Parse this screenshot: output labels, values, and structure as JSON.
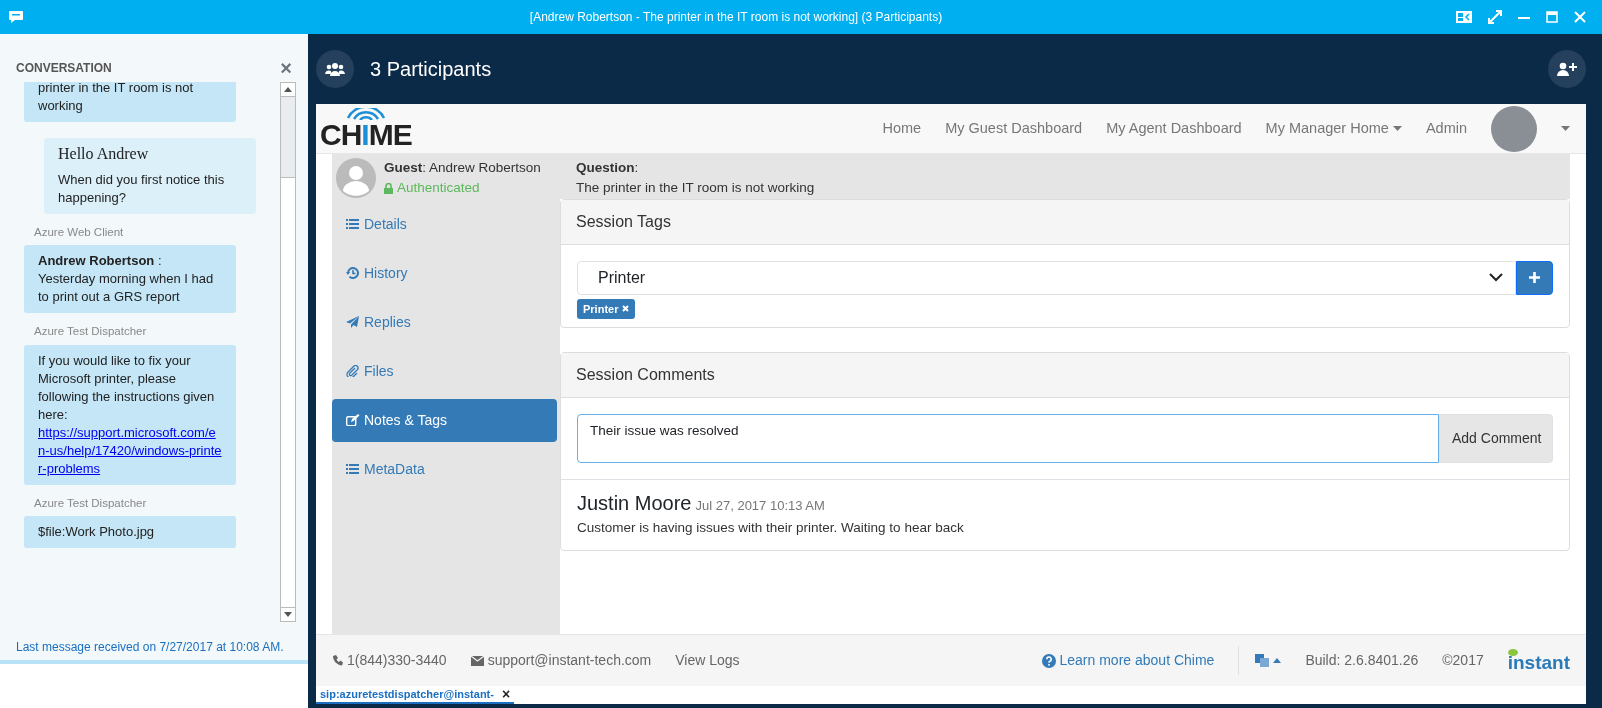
{
  "window": {
    "title": "[Andrew Robertson - The printer in the IT room is not working] (3 Participants)"
  },
  "conversation": {
    "title": "CONVERSATION",
    "close": "×",
    "messages": [
      {
        "kind": "incoming",
        "text": "printer in the IT room is not working",
        "cut": true
      },
      {
        "kind": "outgoing",
        "heading": "Hello Andrew",
        "text": "When did you first notice this happening?"
      },
      {
        "kind": "incoming",
        "sender": "Azure Web Client",
        "text": "**Andrew Robertson** : Yesterday morning when I had to print out a GRS report"
      },
      {
        "kind": "incoming",
        "sender": "Azure Test Dispatcher",
        "text": "If you would like to fix your Microsoft printer, please following the instructions given here:",
        "link": "https://support.microsoft.com/en-us/help/17420/windows-printer-problems"
      },
      {
        "kind": "incoming",
        "sender": "Azure Test Dispatcher",
        "text": "$file:Work Photo.jpg"
      }
    ],
    "status": "Last message received on 7/27/2017 at 10:08 AM."
  },
  "meeting": {
    "participants": "3 Participants"
  },
  "navbar": {
    "brand": "CHIME",
    "items": [
      {
        "label": "Home",
        "dropdown": false
      },
      {
        "label": "My Guest Dashboard",
        "dropdown": false
      },
      {
        "label": "My Agent Dashboard",
        "dropdown": false
      },
      {
        "label": "My Manager Home",
        "dropdown": true
      },
      {
        "label": "Admin",
        "dropdown": false
      }
    ]
  },
  "guest": {
    "heading": "**Guest**: Andrew Robertson",
    "status": "Authenticated",
    "question_label": "**Question**:",
    "question": "The printer in the IT room is not working"
  },
  "side_tabs": [
    {
      "label": "Details",
      "kind": "list",
      "selected": false
    },
    {
      "label": "History",
      "kind": "history",
      "selected": false
    },
    {
      "label": "Replies",
      "kind": "send",
      "selected": false
    },
    {
      "label": "Files",
      "kind": "clip",
      "selected": false
    },
    {
      "label": "Notes & Tags",
      "kind": "edit",
      "selected": true
    },
    {
      "label": "MetaData",
      "kind": "list",
      "selected": false
    }
  ],
  "session_tags": {
    "title": "Session Tags",
    "value": "Printer",
    "tags": [
      {
        "label": "Printer"
      }
    ]
  },
  "session_comments": {
    "title": "Session Comments",
    "value": "Their issue was resolved",
    "button": "Add Comment",
    "comments": [
      {
        "author": "Justin Moore",
        "time": "Jul 27, 2017 10:13 AM",
        "text": "Customer is having issues with their printer. Waiting to hear back"
      }
    ]
  },
  "footer": {
    "phone": "1(844)330-3440",
    "email": "support@instant-tech.com",
    "logs": "View Logs",
    "learn": "Learn more about Chime",
    "build": "Build: 2.6.8401.26",
    "copyright": "©2017",
    "logo": "instant"
  },
  "bottom_tab": {
    "label": "sip:azuretestdispatcher@instant-",
    "close": "×"
  }
}
